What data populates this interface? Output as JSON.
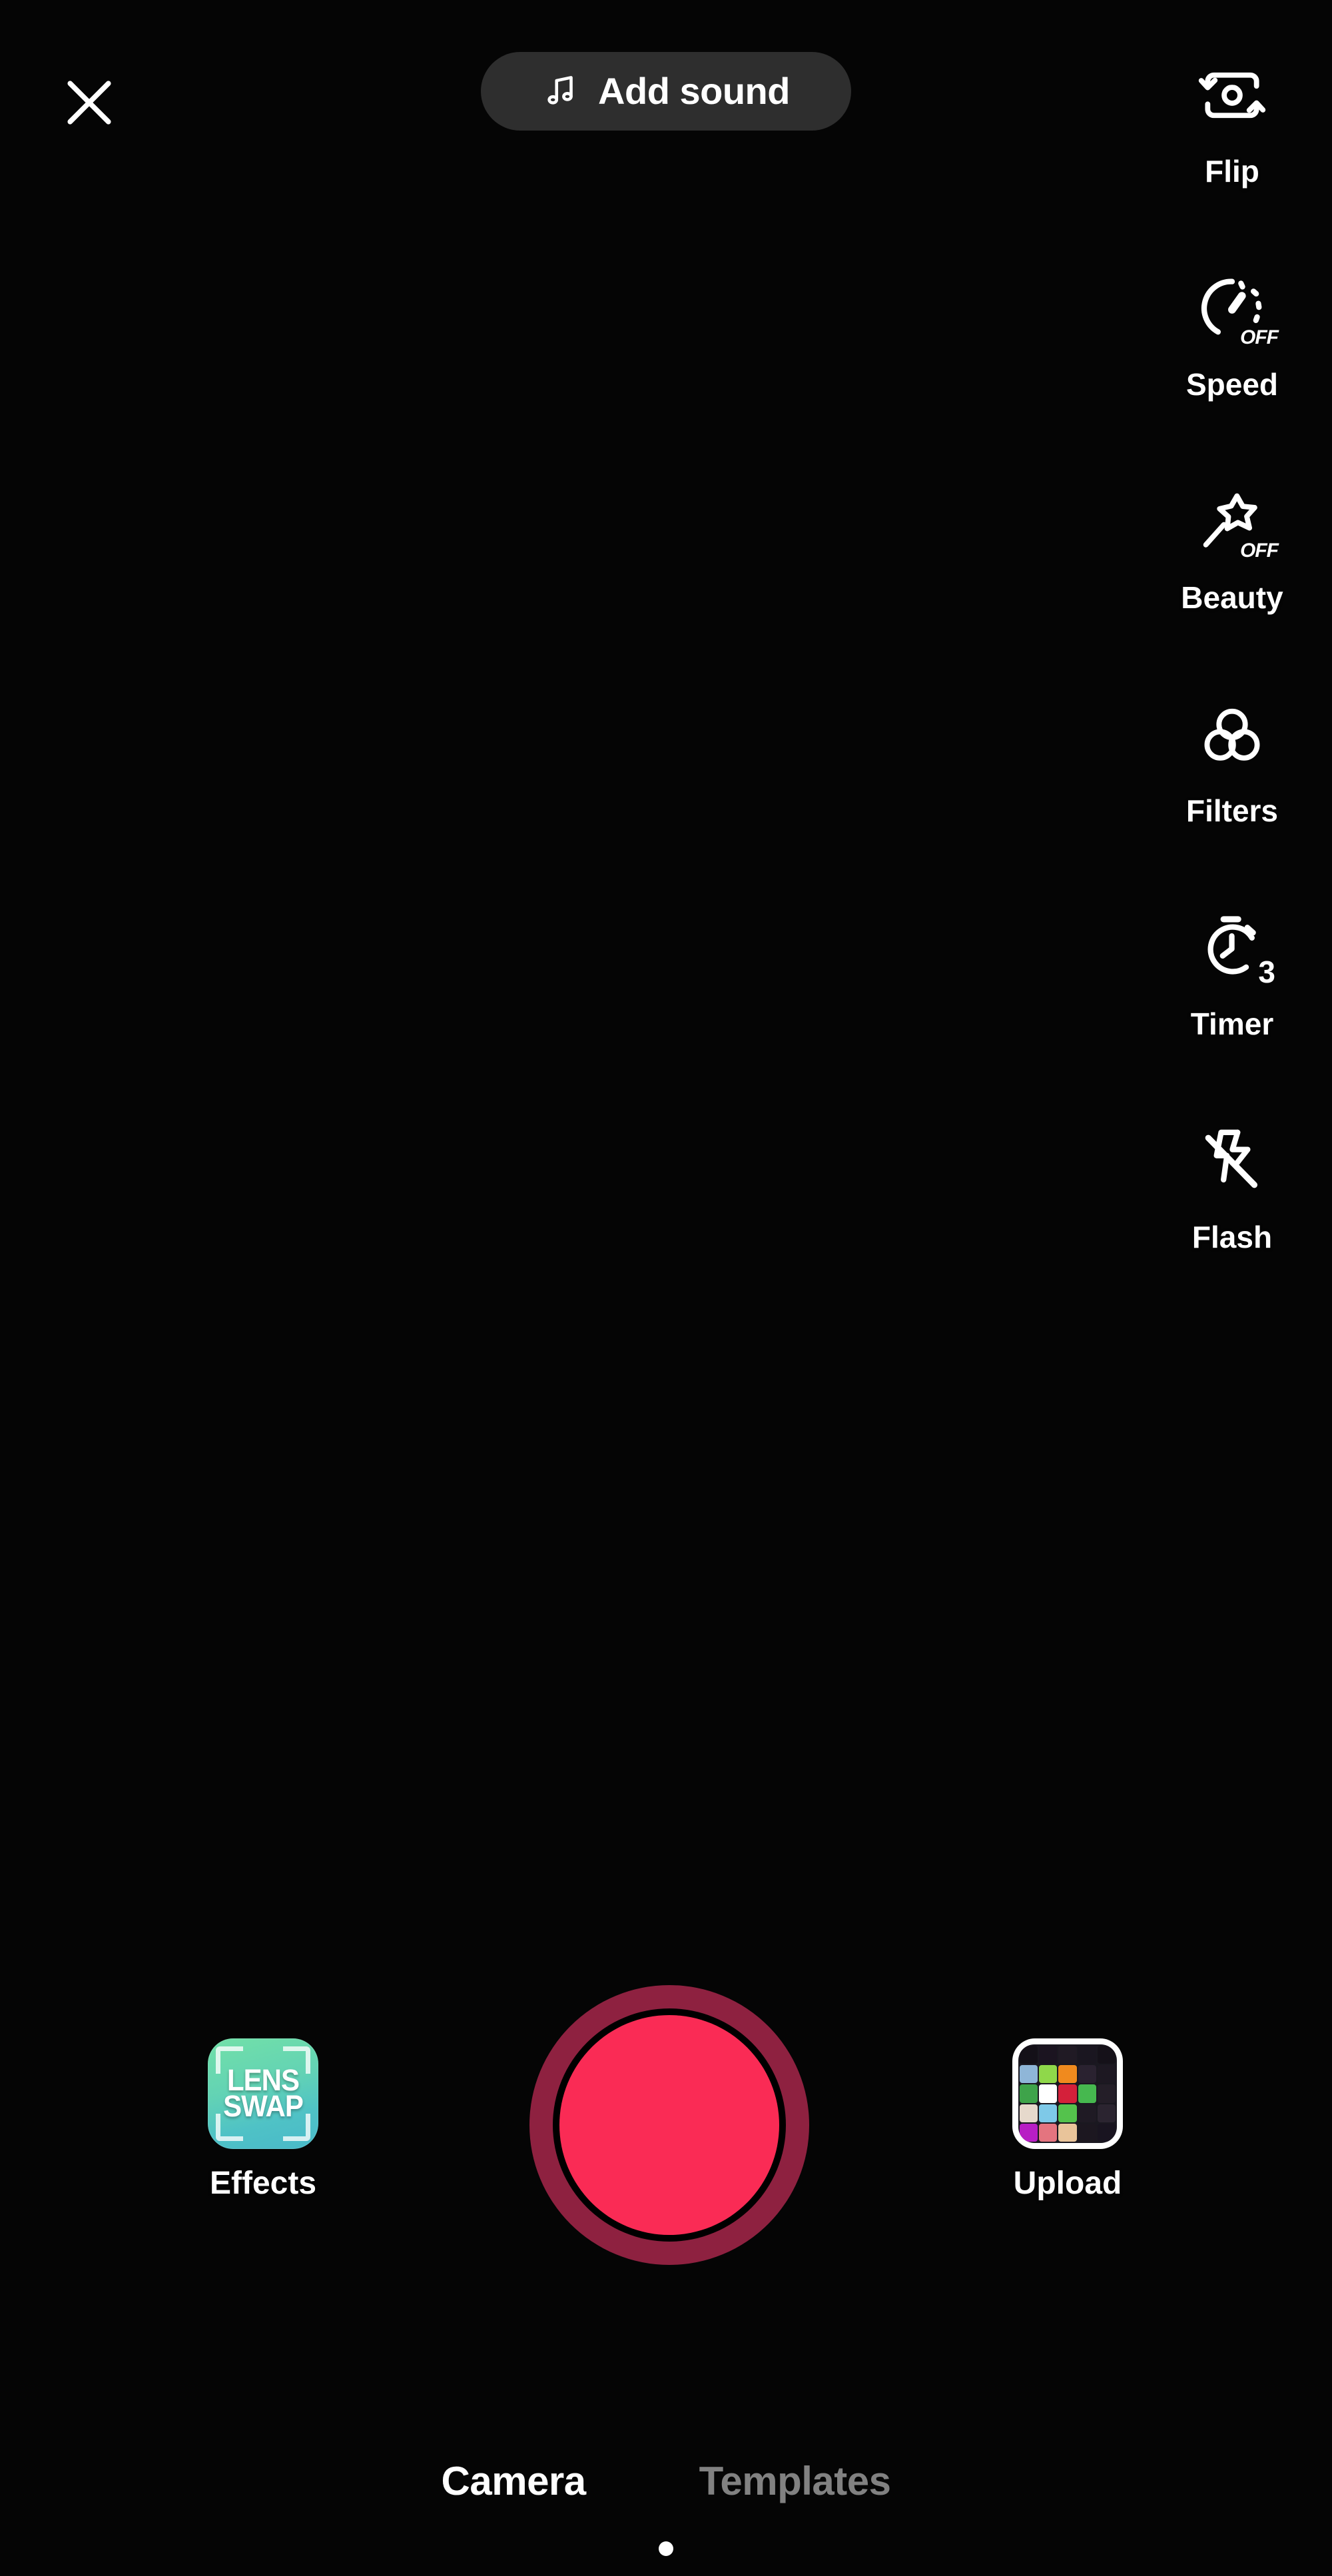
{
  "app": {
    "screen_name": "Camera",
    "background_color": "#000000"
  },
  "top_bar": {
    "close_icon": "close-icon",
    "add_sound": {
      "label": "Add sound",
      "icon": "music-note-icon",
      "pill_color": "#2e2e2e"
    }
  },
  "side_toolbar": {
    "items": [
      {
        "label": "Flip",
        "icon": "camera-flip-icon",
        "badge": ""
      },
      {
        "label": "Speed",
        "icon": "speedometer-icon",
        "badge": "OFF"
      },
      {
        "label": "Beauty",
        "icon": "magic-wand-icon",
        "badge": "OFF"
      },
      {
        "label": "Filters",
        "icon": "filters-circles-icon",
        "badge": ""
      },
      {
        "label": "Timer",
        "icon": "stopwatch-icon",
        "badge": "3"
      },
      {
        "label": "Flash",
        "icon": "flash-off-icon",
        "badge": ""
      }
    ]
  },
  "bottom_controls": {
    "effects": {
      "label": "Effects",
      "thumbnail_text_line1": "LENS",
      "thumbnail_text_line2": "SWAP",
      "thumbnail_color_start": "#72e0a8",
      "thumbnail_color_end": "#49b9c9"
    },
    "record": {
      "label": "",
      "inner_color": "#fa2b55",
      "ring_color": "#8e2140"
    },
    "upload": {
      "label": "Upload",
      "thumbnail_type": "photo-gallery-grid"
    }
  },
  "bottom_tabs": {
    "tabs": [
      {
        "label": "Camera",
        "active": true
      },
      {
        "label": "Templates",
        "active": false
      }
    ],
    "active_color": "#ffffff",
    "inactive_color": "#818181"
  },
  "gallery_cells": [
    "#141018",
    "#1b1420",
    "#201a24",
    "#1a1620",
    "#151119",
    "#8fb6d8",
    "#8fd84a",
    "#f08a1e",
    "#2a2230",
    "#1d1822",
    "#3ea34a",
    "#ffffff",
    "#d4203a",
    "#46b84f",
    "#241e28",
    "#e6d9cc",
    "#7ec9e8",
    "#54c24c",
    "#1f1a24",
    "#2b2430",
    "#b81ec4",
    "#e4747f",
    "#e9c49a",
    "#1c1720",
    "#191420"
  ]
}
